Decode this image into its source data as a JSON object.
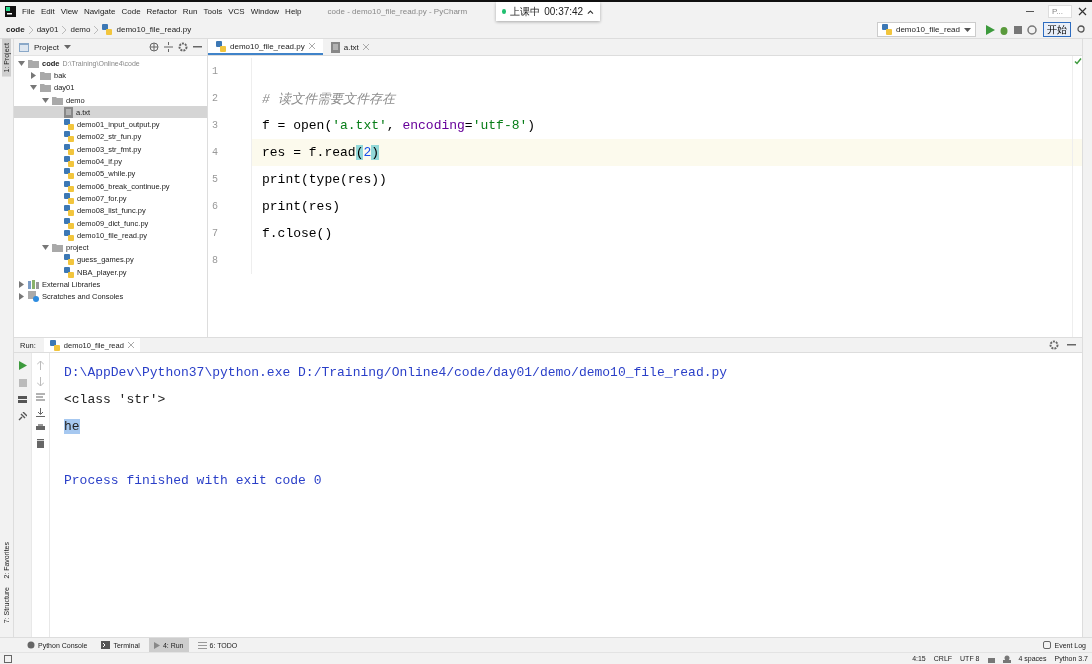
{
  "menu": [
    "File",
    "Edit",
    "View",
    "Navigate",
    "Code",
    "Refactor",
    "Run",
    "Tools",
    "VCS",
    "Window",
    "Help"
  ],
  "window_title": "code - demo10_file_read.py - PyCharm",
  "recorder": {
    "status": "上课中",
    "time": "00:37:42"
  },
  "corner": {
    "label": "P...",
    "button": "开始"
  },
  "breadcrumb": [
    "code",
    "day01",
    "demo",
    "demo10_file_read.py"
  ],
  "run_config": "demo10_file_read",
  "side_tabs": [
    {
      "label": "1: Project",
      "selected": true
    },
    {
      "label": "2: Favorites",
      "selected": false
    },
    {
      "label": "7: Structure",
      "selected": false
    }
  ],
  "project_panel": {
    "title": "Project",
    "tree": [
      {
        "label": "code",
        "hint": "D:\\Training\\Online4\\code",
        "kind": "folder",
        "expanded": true,
        "selected": false,
        "children": [
          {
            "label": "bak",
            "kind": "folder",
            "expanded": false,
            "selected": false
          },
          {
            "label": "day01",
            "kind": "folder",
            "expanded": true,
            "selected": false,
            "children": [
              {
                "label": "demo",
                "kind": "folder",
                "expanded": true,
                "selected": false,
                "children": [
                  {
                    "label": "a.txt",
                    "kind": "text",
                    "selected": true
                  },
                  {
                    "label": "demo01_input_output.py",
                    "kind": "python",
                    "selected": false
                  },
                  {
                    "label": "demo02_str_fun.py",
                    "kind": "python",
                    "selected": false
                  },
                  {
                    "label": "demo03_str_fmt.py",
                    "kind": "python",
                    "selected": false
                  },
                  {
                    "label": "demo04_if.py",
                    "kind": "python",
                    "selected": false
                  },
                  {
                    "label": "demo05_while.py",
                    "kind": "python",
                    "selected": false
                  },
                  {
                    "label": "demo06_break_continue.py",
                    "kind": "python",
                    "selected": false
                  },
                  {
                    "label": "demo07_for.py",
                    "kind": "python",
                    "selected": false
                  },
                  {
                    "label": "demo08_list_func.py",
                    "kind": "python",
                    "selected": false
                  },
                  {
                    "label": "demo09_dict_func.py",
                    "kind": "python",
                    "selected": false
                  },
                  {
                    "label": "demo10_file_read.py",
                    "kind": "python",
                    "selected": false
                  }
                ]
              },
              {
                "label": "project",
                "kind": "folder",
                "expanded": true,
                "selected": false,
                "children": [
                  {
                    "label": "guess_games.py",
                    "kind": "python",
                    "selected": false
                  },
                  {
                    "label": "NBA_player.py",
                    "kind": "python",
                    "selected": false
                  }
                ]
              }
            ]
          }
        ]
      },
      {
        "label": "External Libraries",
        "kind": "library",
        "expanded": false,
        "selected": false
      },
      {
        "label": "Scratches and Consoles",
        "kind": "scratch",
        "expanded": false,
        "selected": false
      }
    ]
  },
  "editor_tabs": [
    {
      "label": "demo10_file_read.py",
      "kind": "python",
      "selected": true
    },
    {
      "label": "a.txt",
      "kind": "text",
      "selected": false
    }
  ],
  "code_lines": [
    {
      "number": "1",
      "current": false
    },
    {
      "number": "2",
      "current": false,
      "parts": [
        {
          "text": "# 读文件需要文件存在",
          "kind": "comment"
        }
      ]
    },
    {
      "number": "3",
      "current": false,
      "parts": [
        {
          "text": "f = open(",
          "kind": "plain"
        },
        {
          "text": "'a.txt'",
          "kind": "string"
        },
        {
          "text": ", ",
          "kind": "plain"
        },
        {
          "text": "encoding",
          "kind": "param"
        },
        {
          "text": "=",
          "kind": "plain"
        },
        {
          "text": "'utf-8'",
          "kind": "string"
        },
        {
          "text": ")",
          "kind": "plain"
        }
      ]
    },
    {
      "number": "4",
      "current": true,
      "parts": [
        {
          "text": "res = f.read",
          "kind": "plain"
        },
        {
          "text": "(",
          "kind": "brace"
        },
        {
          "text": "2",
          "kind": "number"
        },
        {
          "text": ")",
          "kind": "brace"
        }
      ]
    },
    {
      "number": "5",
      "current": false,
      "parts": [
        {
          "text": "print(type(res))",
          "kind": "plain"
        }
      ]
    },
    {
      "number": "6",
      "current": false,
      "parts": [
        {
          "text": "print(res)",
          "kind": "plain"
        }
      ]
    },
    {
      "number": "7",
      "current": false,
      "parts": [
        {
          "text": "f.close()",
          "kind": "plain"
        }
      ]
    },
    {
      "number": "8",
      "current": false
    }
  ],
  "run_panel": {
    "label": "Run:",
    "tab": "demo10_file_read",
    "output": [
      {
        "text": "D:\\AppDev\\Python37\\python.exe D:/Training/Online4/code/day01/demo/demo10_file_read.py",
        "kind": "command",
        "selected": false
      },
      {
        "text": "<class 'str'>",
        "kind": "output",
        "selected": false
      },
      {
        "text": "he",
        "kind": "output",
        "selected": true
      },
      {
        "text": "Process finished with exit code 0",
        "kind": "status",
        "selected": false
      }
    ]
  },
  "bottom_tabs": [
    {
      "label": "Python Console",
      "kind": "python",
      "selected": false
    },
    {
      "label": "Terminal",
      "kind": "terminal",
      "selected": false
    },
    {
      "label": "4: Run",
      "kind": "run",
      "selected": true
    },
    {
      "label": "6: TODO",
      "kind": "todo",
      "selected": false
    }
  ],
  "status": {
    "event_log": "Event Log",
    "items": [
      "4:15",
      "CRLF",
      "UTF 8",
      "4 spaces",
      "Python 3.7"
    ]
  }
}
